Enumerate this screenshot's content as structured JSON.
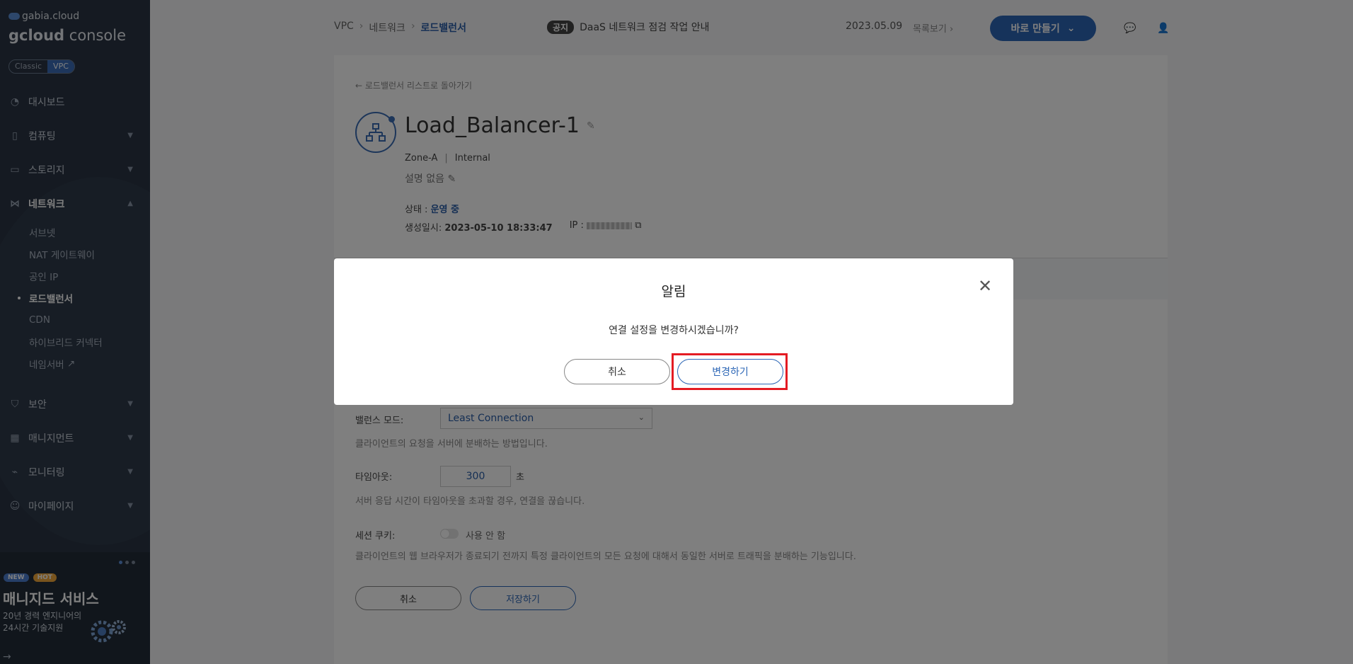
{
  "sidebar": {
    "brand_small": "gabia.cloud",
    "brand_big_a": "gcloud",
    "brand_big_b": " console",
    "env": {
      "classic": "Classic",
      "vpc": "VPC"
    },
    "items": [
      {
        "label": "대시보드",
        "icon": "dashboard-icon"
      },
      {
        "label": "컴퓨팅",
        "icon": "server-icon"
      },
      {
        "label": "스토리지",
        "icon": "storage-icon"
      },
      {
        "label": "네트워크",
        "icon": "network-icon"
      }
    ],
    "network_sub": [
      {
        "label": "서브넷"
      },
      {
        "label": "NAT 게이트웨이"
      },
      {
        "label": "공인 IP"
      },
      {
        "label": "로드밸런서"
      },
      {
        "label": "CDN"
      },
      {
        "label": "하이브리드 커넥터"
      },
      {
        "label": "네임서버"
      }
    ],
    "items_after": [
      {
        "label": "보안",
        "icon": "shield-icon"
      },
      {
        "label": "매니지먼트",
        "icon": "management-icon"
      },
      {
        "label": "모니터링",
        "icon": "monitoring-icon"
      },
      {
        "label": "마이페이지",
        "icon": "user-icon"
      }
    ],
    "promo": {
      "badge_new": "NEW",
      "badge_hot": "HOT",
      "title": "매니지드 서비스",
      "desc_line1": "20년 경력 엔지니어의",
      "desc_line2": "24시간 기술지원"
    }
  },
  "header": {
    "breadcrumb": [
      "VPC",
      "네트워크",
      "로드밸런서"
    ],
    "notice_tag": "공지",
    "notice_text": "DaaS 네트워크 점검 작업 안내",
    "notice_date": "2023.05.09",
    "notice_list": "목록보기",
    "create_button": "바로 만들기"
  },
  "detail": {
    "back_link": "로드밸런서 리스트로 돌아가기",
    "name": "Load_Balancer-1",
    "zone": "Zone-A",
    "type": "Internal",
    "desc": "설명 없음",
    "status_label": "상태 : ",
    "status_value": "운영 중",
    "created_label": "생성일시: ",
    "created_value": "2023-05-10 18:33:47",
    "ip_label": "IP : "
  },
  "settings": {
    "balance_label": "밸런스 모드:",
    "balance_value": "Least Connection",
    "balance_help": "클라이언트의 요청을 서버에 분배하는 방법입니다.",
    "timeout_label": "타임아웃:",
    "timeout_value": "300",
    "timeout_unit": "초",
    "timeout_help": "서버 응답 시간이 타임아웃을 초과할 경우, 연결을 끊습니다.",
    "cookie_label": "세션 쿠키:",
    "cookie_value": "사용 안 함",
    "cookie_help": "클라이언트의 웹 브라우저가 종료되기 전까지 특정 클라이언트의 모든 요청에 대해서 동일한 서버로 트래픽을 분배하는 기능입니다.",
    "cancel": "취소",
    "save": "저장하기"
  },
  "modal": {
    "title": "알림",
    "message": "연결 설정을 변경하시겠습니까?",
    "cancel": "취소",
    "confirm": "변경하기"
  },
  "colors": {
    "accent": "#2c66b6",
    "sidebar_bg": "#2b3544",
    "highlight": "#e41b23"
  }
}
